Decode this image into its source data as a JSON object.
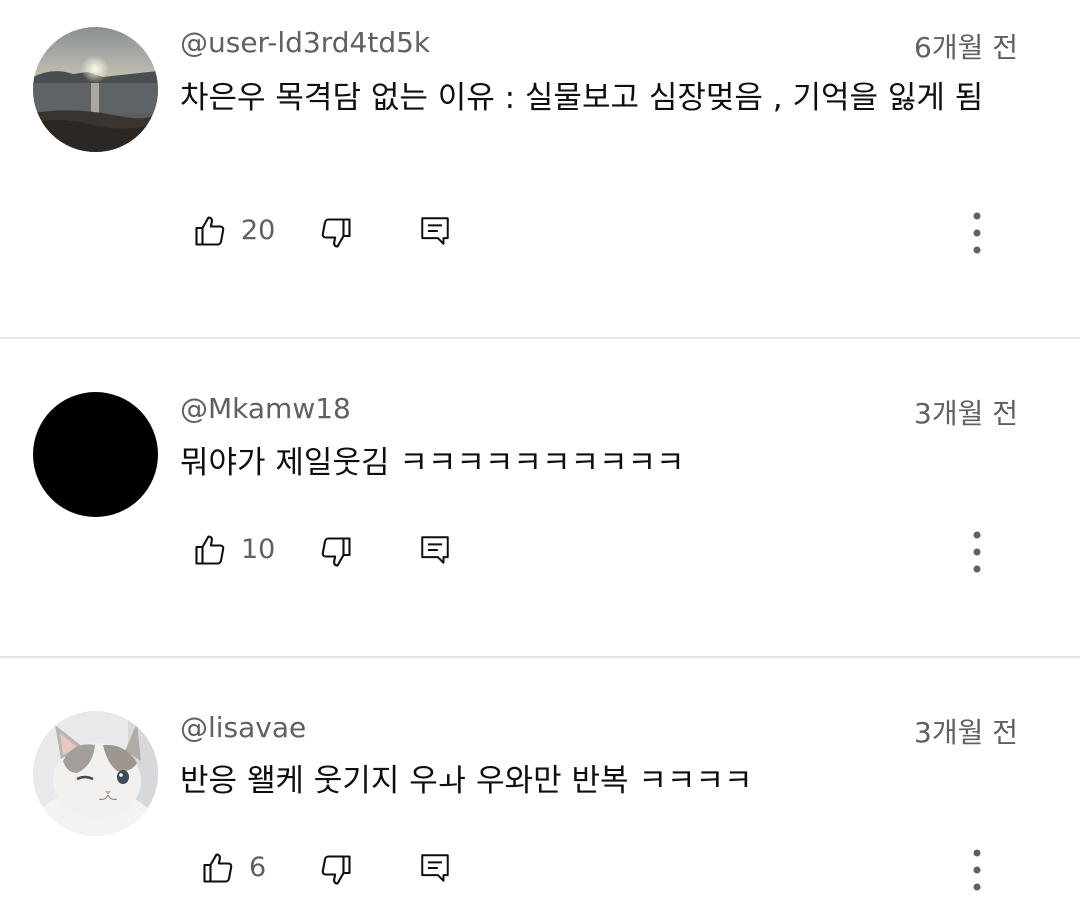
{
  "comments": [
    {
      "author": "@user-ld3rd4td5k",
      "time": "6개월 전",
      "text": "차은우 목격담 없는 이유 : 실물보고 심장멎음 , 기억을 잃게 됨",
      "likes": "20",
      "avatar": "sunset-beach-photo"
    },
    {
      "author": "@Mkamw18",
      "time": "3개월 전",
      "text": "뭐야가 제일웃김 ㅋㅋㅋㅋㅋㅋㅋㅋㅋㅋ",
      "likes": "10",
      "avatar": "black-circle"
    },
    {
      "author": "@lisavae",
      "time": "3개월 전",
      "text": "반응 왤케 웃기지 우ㅘ 우와만 반복 ㅋㅋㅋㅋ",
      "likes": "6",
      "avatar": "kitten-photo"
    }
  ],
  "icons": {
    "like": "thumbs-up-icon",
    "dislike": "thumbs-down-icon",
    "reply": "reply-icon",
    "more": "more-vertical-icon"
  },
  "colors": {
    "text_primary": "#0f0f0f",
    "text_secondary": "#606060",
    "divider": "#e5e5e5",
    "background": "#ffffff"
  }
}
